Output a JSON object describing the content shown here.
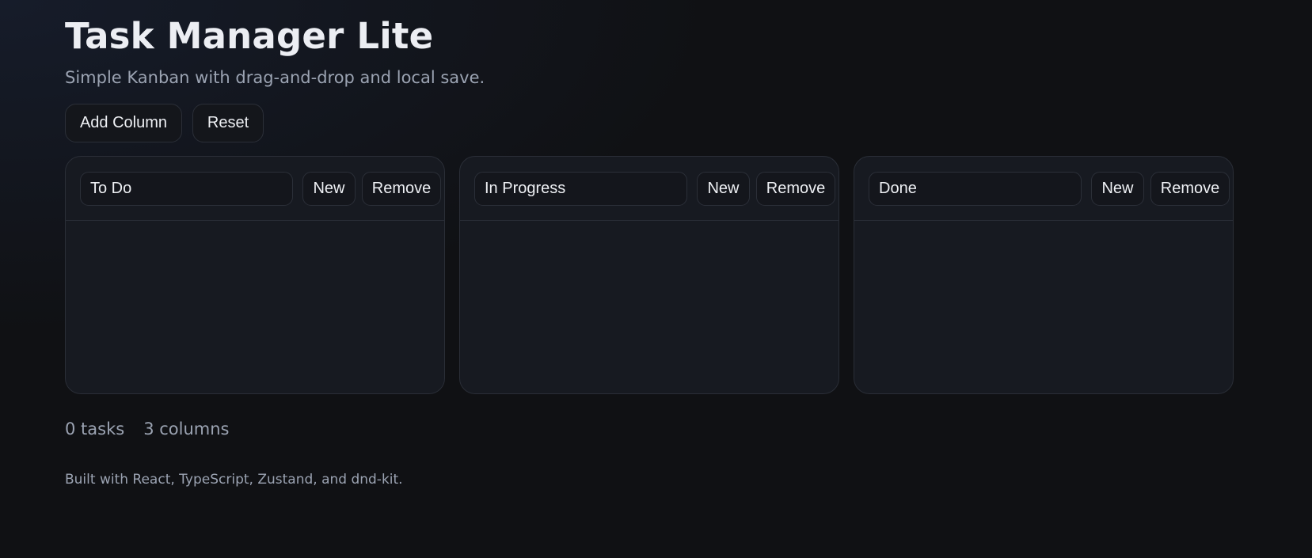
{
  "header": {
    "title": "Task Manager Lite",
    "subtitle": "Simple Kanban with drag-and-drop and local save."
  },
  "toolbar": {
    "add_column_label": "Add Column",
    "reset_label": "Reset"
  },
  "columns": [
    {
      "title": "To Do",
      "new_label": "New",
      "remove_label": "Remove"
    },
    {
      "title": "In Progress",
      "new_label": "New",
      "remove_label": "Remove"
    },
    {
      "title": "Done",
      "new_label": "New",
      "remove_label": "Remove"
    }
  ],
  "stats": {
    "tasks": "0 tasks",
    "columns": "3 columns"
  },
  "footer": {
    "note": "Built with React, TypeScript, Zustand, and dnd-kit."
  },
  "colors": {
    "background": "#101114",
    "panel": "#171a21",
    "border": "#2b2f38",
    "text": "#eef0f4",
    "muted_text": "#9ba3b2"
  }
}
